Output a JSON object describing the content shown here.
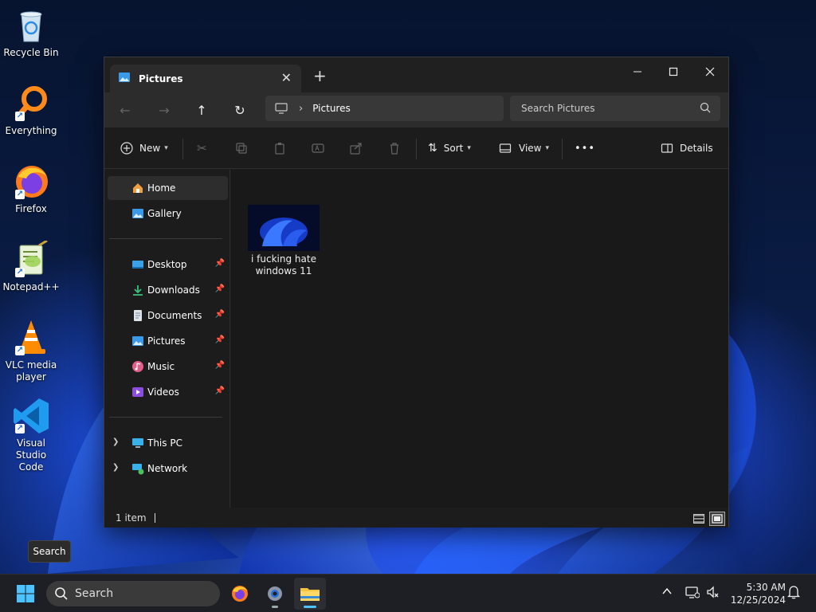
{
  "desktop": {
    "icons": [
      {
        "label": "Recycle Bin"
      },
      {
        "label": "Everything"
      },
      {
        "label": "Firefox"
      },
      {
        "label": "Notepad++"
      },
      {
        "label": "VLC media player"
      },
      {
        "label": "Visual Studio Code"
      }
    ]
  },
  "explorer": {
    "tab_title": "Pictures",
    "new_tab": "+",
    "address": {
      "path": "Pictures"
    },
    "search_placeholder": "Search Pictures",
    "commands": {
      "new": "New",
      "sort": "Sort",
      "view": "View",
      "more": "•••",
      "details": "Details"
    },
    "sidebar": {
      "top": [
        {
          "label": "Home"
        },
        {
          "label": "Gallery"
        }
      ],
      "quick_access": [
        {
          "label": "Desktop"
        },
        {
          "label": "Downloads"
        },
        {
          "label": "Documents"
        },
        {
          "label": "Pictures"
        },
        {
          "label": "Music"
        },
        {
          "label": "Videos"
        }
      ],
      "locations": [
        {
          "label": "This PC"
        },
        {
          "label": "Network"
        }
      ]
    },
    "files": [
      {
        "name": "i fucking hate windows 11"
      }
    ],
    "status": {
      "count": "1 item"
    }
  },
  "tooltip": {
    "text": "Search"
  },
  "taskbar": {
    "search_placeholder": "Search",
    "clock": {
      "time": "5:30 AM",
      "date": "12/25/2024"
    }
  },
  "colors": {
    "accent": "#4cc2ff",
    "window_bg": "#1c1c1c",
    "taskbar_bg": "#1e1f24"
  }
}
